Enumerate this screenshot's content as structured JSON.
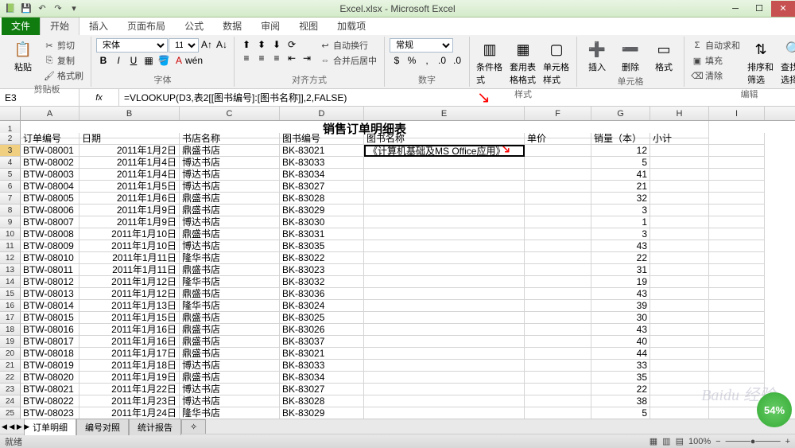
{
  "window": {
    "title": "Excel.xlsx - Microsoft Excel",
    "qat": [
      "save",
      "undo",
      "redo"
    ]
  },
  "menu": {
    "file": "文件",
    "tabs": [
      "开始",
      "插入",
      "页面布局",
      "公式",
      "数据",
      "审阅",
      "视图",
      "加载项"
    ],
    "active": "开始"
  },
  "ribbon": {
    "clipboard": {
      "paste": "粘贴",
      "cut": "剪切",
      "copy": "复制",
      "format_painter": "格式刷",
      "label": "剪贴板"
    },
    "font": {
      "name": "宋体",
      "size": "11",
      "label": "字体"
    },
    "align": {
      "wrap": "自动换行",
      "merge": "合并后居中",
      "label": "对齐方式"
    },
    "number": {
      "format": "常规",
      "label": "数字"
    },
    "styles": {
      "cond": "条件格式",
      "table": "套用表格格式",
      "cell": "单元格样式",
      "label": "样式"
    },
    "cells": {
      "insert": "插入",
      "delete": "删除",
      "format": "格式",
      "label": "单元格"
    },
    "editing": {
      "sum": "自动求和",
      "fill": "填充",
      "clear": "清除",
      "sort": "排序和筛选",
      "find": "查找和选择",
      "label": "编辑"
    }
  },
  "namebox": "E3",
  "formula": "=VLOOKUP(D3,表2[[图书编号]:[图书名称]],2,FALSE)",
  "columns": [
    "A",
    "B",
    "C",
    "D",
    "E",
    "F",
    "G",
    "H",
    "I"
  ],
  "sheet_title": "销售订单明细表",
  "headers": {
    "A": "订单编号",
    "B": "日期",
    "C": "书店名称",
    "D": "图书编号",
    "E": "图书名称",
    "F": "单价",
    "G": "销量（本）",
    "H": "小计"
  },
  "active_cell_value": "《计算机基础及MS Office应用》",
  "rows": [
    {
      "n": 3,
      "A": "BTW-08001",
      "B": "2011年1月2日",
      "C": "鼎盛书店",
      "D": "BK-83021",
      "G": 12
    },
    {
      "n": 4,
      "A": "BTW-08002",
      "B": "2011年1月4日",
      "C": "博达书店",
      "D": "BK-83033",
      "G": 5
    },
    {
      "n": 5,
      "A": "BTW-08003",
      "B": "2011年1月4日",
      "C": "博达书店",
      "D": "BK-83034",
      "G": 41
    },
    {
      "n": 6,
      "A": "BTW-08004",
      "B": "2011年1月5日",
      "C": "博达书店",
      "D": "BK-83027",
      "G": 21
    },
    {
      "n": 7,
      "A": "BTW-08005",
      "B": "2011年1月6日",
      "C": "鼎盛书店",
      "D": "BK-83028",
      "G": 32
    },
    {
      "n": 8,
      "A": "BTW-08006",
      "B": "2011年1月9日",
      "C": "鼎盛书店",
      "D": "BK-83029",
      "G": 3
    },
    {
      "n": 9,
      "A": "BTW-08007",
      "B": "2011年1月9日",
      "C": "博达书店",
      "D": "BK-83030",
      "G": 1
    },
    {
      "n": 10,
      "A": "BTW-08008",
      "B": "2011年1月10日",
      "C": "鼎盛书店",
      "D": "BK-83031",
      "G": 3
    },
    {
      "n": 11,
      "A": "BTW-08009",
      "B": "2011年1月10日",
      "C": "博达书店",
      "D": "BK-83035",
      "G": 43
    },
    {
      "n": 12,
      "A": "BTW-08010",
      "B": "2011年1月11日",
      "C": "隆华书店",
      "D": "BK-83022",
      "G": 22
    },
    {
      "n": 13,
      "A": "BTW-08011",
      "B": "2011年1月11日",
      "C": "鼎盛书店",
      "D": "BK-83023",
      "G": 31
    },
    {
      "n": 14,
      "A": "BTW-08012",
      "B": "2011年1月12日",
      "C": "隆华书店",
      "D": "BK-83032",
      "G": 19
    },
    {
      "n": 15,
      "A": "BTW-08013",
      "B": "2011年1月12日",
      "C": "鼎盛书店",
      "D": "BK-83036",
      "G": 43
    },
    {
      "n": 16,
      "A": "BTW-08014",
      "B": "2011年1月13日",
      "C": "隆华书店",
      "D": "BK-83024",
      "G": 39
    },
    {
      "n": 17,
      "A": "BTW-08015",
      "B": "2011年1月15日",
      "C": "鼎盛书店",
      "D": "BK-83025",
      "G": 30
    },
    {
      "n": 18,
      "A": "BTW-08016",
      "B": "2011年1月16日",
      "C": "鼎盛书店",
      "D": "BK-83026",
      "G": 43
    },
    {
      "n": 19,
      "A": "BTW-08017",
      "B": "2011年1月16日",
      "C": "鼎盛书店",
      "D": "BK-83037",
      "G": 40
    },
    {
      "n": 20,
      "A": "BTW-08018",
      "B": "2011年1月17日",
      "C": "鼎盛书店",
      "D": "BK-83021",
      "G": 44
    },
    {
      "n": 21,
      "A": "BTW-08019",
      "B": "2011年1月18日",
      "C": "博达书店",
      "D": "BK-83033",
      "G": 33
    },
    {
      "n": 22,
      "A": "BTW-08020",
      "B": "2011年1月19日",
      "C": "鼎盛书店",
      "D": "BK-83034",
      "G": 35
    },
    {
      "n": 23,
      "A": "BTW-08021",
      "B": "2011年1月22日",
      "C": "博达书店",
      "D": "BK-83027",
      "G": 22
    },
    {
      "n": 24,
      "A": "BTW-08022",
      "B": "2011年1月23日",
      "C": "博达书店",
      "D": "BK-83028",
      "G": 38
    },
    {
      "n": 25,
      "A": "BTW-08023",
      "B": "2011年1月24日",
      "C": "隆华书店",
      "D": "BK-83029",
      "G": 5
    }
  ],
  "tabs": {
    "active": "订单明细",
    "others": [
      "编号对照",
      "统计报告"
    ]
  },
  "status": {
    "mode": "就绪",
    "zoom": "100%"
  },
  "watermark": "Baidu 经验",
  "progress": "54%"
}
